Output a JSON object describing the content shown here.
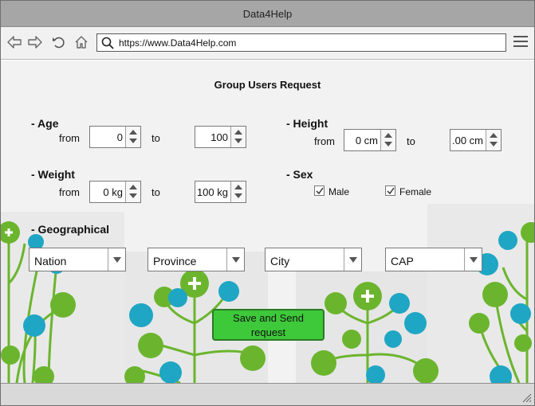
{
  "window": {
    "title": "Data4Help"
  },
  "browser": {
    "url": "https://www.Data4Help.com",
    "icons": [
      "back-icon",
      "forward-icon",
      "refresh-icon",
      "home-icon",
      "search-icon",
      "hamburger-menu-icon"
    ]
  },
  "form": {
    "title": "Group Users Request",
    "age": {
      "label": "- Age",
      "from_label": "from",
      "to_label": "to",
      "from_value": "0",
      "to_value": "100"
    },
    "height": {
      "label": "- Height",
      "from_label": "from",
      "to_label": "to",
      "from_value": "0 cm",
      "to_value": ".00 cm"
    },
    "weight": {
      "label": "- Weight",
      "from_label": "from",
      "to_label": "to",
      "from_value": "0 kg",
      "to_value": "100 kg"
    },
    "sex": {
      "label": "- Sex",
      "options": [
        {
          "label": "Male",
          "checked": true
        },
        {
          "label": "Female",
          "checked": true
        }
      ]
    },
    "geo": {
      "label": "- Geographical",
      "selects": [
        "Nation",
        "Province",
        "City",
        "CAP"
      ]
    },
    "submit_label_line1": "Save and Send",
    "submit_label_line2": "request"
  },
  "colors": {
    "accent_green": "#3ec93b",
    "titlebar": "#a6a6a6",
    "tree_green": "#6bb52e",
    "icon_teal": "#1fa6c4"
  }
}
